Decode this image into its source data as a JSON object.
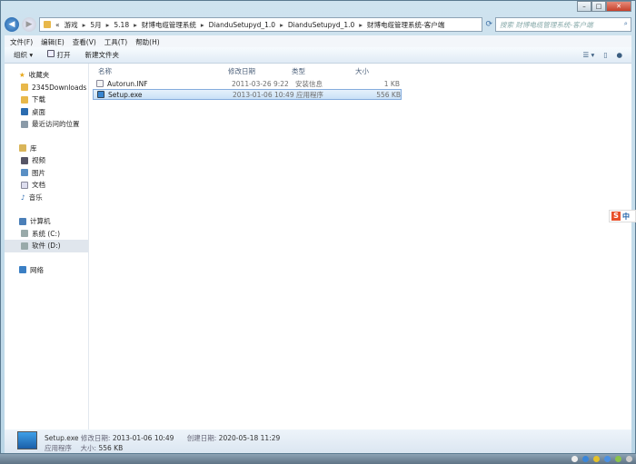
{
  "window": {
    "minimize": "–",
    "maximize": "□",
    "close": "✕"
  },
  "address": {
    "overflow": "«",
    "crumbs": [
      "游戏",
      "5月",
      "5.18",
      "财博电缆管理系统",
      "DianduSetupyd_1.0",
      "DianduSetupyd_1.0",
      "财博电缆管理系统-客户端"
    ],
    "search_placeholder": "搜索 财博电缆管理系统-客户端"
  },
  "menu": [
    "文件(F)",
    "编辑(E)",
    "查看(V)",
    "工具(T)",
    "帮助(H)"
  ],
  "toolbar": {
    "organize": "组织 ▾",
    "open": "打开",
    "new_folder": "新建文件夹"
  },
  "sidebar": {
    "favorites": {
      "label": "收藏夹",
      "items": [
        "2345Downloads",
        "下载",
        "桌面",
        "最近访问的位置"
      ]
    },
    "libraries": {
      "label": "库",
      "items": [
        "视频",
        "图片",
        "文档",
        "音乐"
      ]
    },
    "computer": {
      "label": "计算机",
      "items": [
        "系统 (C:)",
        "软件 (D:)"
      ]
    },
    "network": {
      "label": "网络"
    }
  },
  "columns": [
    "名称",
    "修改日期",
    "类型",
    "大小"
  ],
  "files": [
    {
      "name": "Autorun.INF",
      "date": "2011-03-26 9:22",
      "type": "安装信息",
      "size": "1 KB"
    },
    {
      "name": "Setup.exe",
      "date": "2013-01-06 10:49",
      "type": "应用程序",
      "size": "556 KB"
    }
  ],
  "status": {
    "name": "Setup.exe",
    "modified_label": "修改日期:",
    "modified": "2013-01-06 10:49",
    "created_label": "创建日期:",
    "created": "2020-05-18 11:29",
    "type": "应用程序",
    "size_label": "大小:",
    "size": "556 KB"
  },
  "ime": {
    "logo": "S",
    "mode": "中"
  }
}
